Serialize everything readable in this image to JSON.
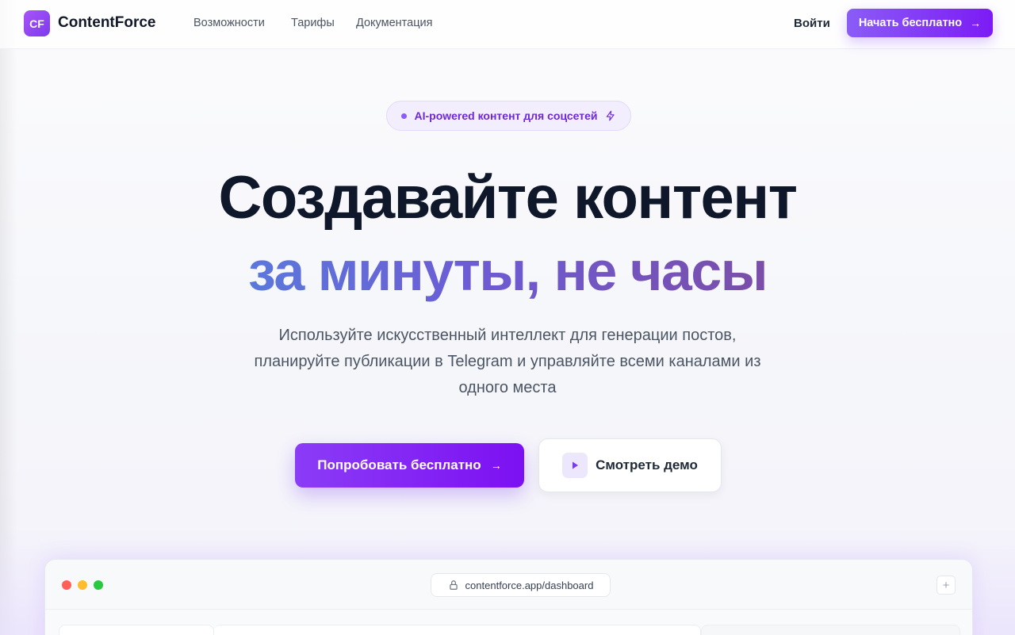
{
  "nav": {
    "logo_mark": "CF",
    "brand": "ContentForce",
    "links": [
      {
        "label": "Возможности"
      },
      {
        "label": "Тарифы"
      },
      {
        "label": "Документация"
      }
    ],
    "login": "Войти",
    "cta": "Начать бесплатно"
  },
  "badge": {
    "text": "AI-powered контент для соцсетей",
    "icon": "bolt-icon"
  },
  "hero": {
    "title_line1": "Создавайте контент",
    "title_line2": "за минуты, не часы",
    "subtitle": "Используйте искусственный интеллект для генерации постов, планируйте публикации в Telegram и управляйте всеми каналами из одного места"
  },
  "actions": {
    "primary": "Попробовать бесплатно",
    "secondary": "Смотреть демо"
  },
  "preview": {
    "url": "contentforce.app/dashboard",
    "colors": {
      "red": "#ff5f57",
      "yellow": "#febc2e",
      "green": "#28c840"
    }
  },
  "colors": {
    "accent": "#7c3aed",
    "accent_light": "#8b5cf6",
    "text_dark": "#0f172a"
  }
}
